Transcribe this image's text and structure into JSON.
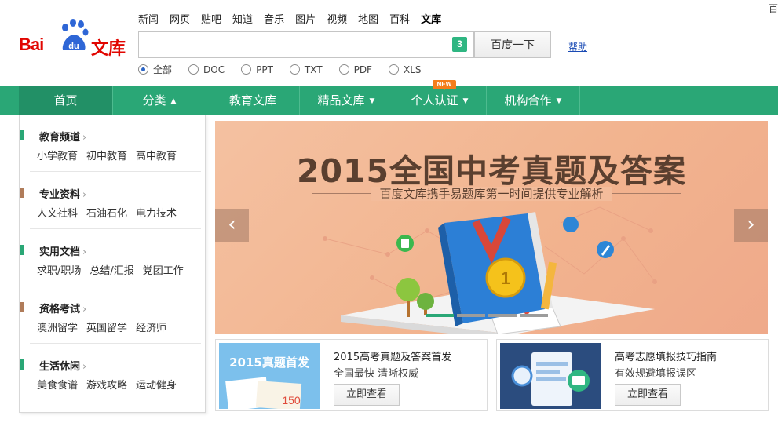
{
  "top_nav": [
    "新闻",
    "网页",
    "贴吧",
    "知道",
    "音乐",
    "图片",
    "视频",
    "地图",
    "百科",
    "文库"
  ],
  "top_nav_active_index": 9,
  "corner_text": "百",
  "logo": {
    "text_left": "Bai",
    "paw_text": "du",
    "text_right": "文库"
  },
  "search": {
    "value": "",
    "placeholder": "",
    "keyboard_badge": "3",
    "button_label": "百度一下",
    "help_label": "帮助"
  },
  "file_types": [
    {
      "label": "全部",
      "checked": true
    },
    {
      "label": "DOC",
      "checked": false
    },
    {
      "label": "PPT",
      "checked": false
    },
    {
      "label": "TXT",
      "checked": false
    },
    {
      "label": "PDF",
      "checked": false
    },
    {
      "label": "XLS",
      "checked": false
    }
  ],
  "main_nav": [
    {
      "label": "首页",
      "has_caret": false
    },
    {
      "label": "分类",
      "has_caret": true,
      "caret": "▲"
    },
    {
      "label": "教育文库",
      "has_caret": false
    },
    {
      "label": "精品文库",
      "has_caret": true,
      "caret": "▼"
    },
    {
      "label": "个人认证",
      "has_caret": true,
      "caret": "▼"
    },
    {
      "label": "机构合作",
      "has_caret": true,
      "caret": "▼"
    }
  ],
  "new_badge": "NEW",
  "categories": [
    {
      "title": "教育频道",
      "color": "#2aa776",
      "links": [
        "小学教育",
        "初中教育",
        "高中教育"
      ]
    },
    {
      "title": "专业资料",
      "color": "#b07c5a",
      "links": [
        "人文社科",
        "石油石化",
        "电力技术"
      ]
    },
    {
      "title": "实用文档",
      "color": "#2aa776",
      "links": [
        "求职/职场",
        "总结/汇报",
        "党团工作"
      ]
    },
    {
      "title": "资格考试",
      "color": "#b07c5a",
      "links": [
        "澳洲留学",
        "英国留学",
        "经济师"
      ]
    },
    {
      "title": "生活休闲",
      "color": "#2aa776",
      "links": [
        "美食食谱",
        "游戏攻略",
        "运动健身"
      ]
    }
  ],
  "banner": {
    "title": "2015全国中考真题及答案",
    "subtitle": "百度文库携手易题库第一时间提供专业解析",
    "medal_number": "1",
    "slides": 4,
    "active_slide": 0
  },
  "cards": [
    {
      "thumb_text": "2015真题首发",
      "thumb_number": "150",
      "title": "2015高考真题及答案首发",
      "subtitle": "全国最快 清晰权威",
      "button": "立即查看"
    },
    {
      "thumb_text": "",
      "title": "高考志愿填报技巧指南",
      "subtitle": "有效规避填报误区",
      "button": "立即查看"
    }
  ],
  "colors": {
    "nav_green": "#2aa776",
    "nav_active": "#229066",
    "brand_red": "#e10601",
    "banner_bg": "#f2b48f",
    "book_blue": "#2c7fd6",
    "medal_gold": "#f5c21b"
  }
}
